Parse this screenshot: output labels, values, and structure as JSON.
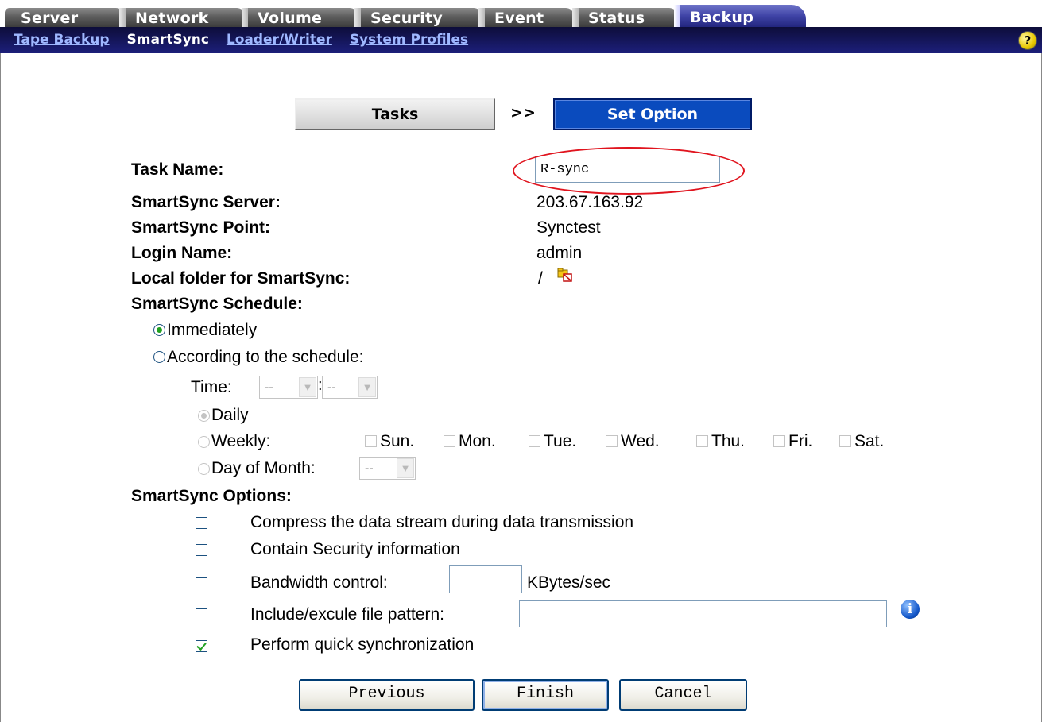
{
  "tabs": [
    "Server",
    "Network",
    "Volume",
    "Security",
    "Event",
    "Status",
    "Backup"
  ],
  "active_tab": "Backup",
  "subnav": {
    "links": [
      "Tape Backup",
      "SmartSync",
      "Loader/Writer",
      "System Profiles"
    ],
    "current": "SmartSync",
    "help_icon": "?"
  },
  "steps": {
    "tasks": "Tasks",
    "arrow": ">>",
    "set_option": "Set Option"
  },
  "form": {
    "task_name_label": "Task Name:",
    "task_name_value": "R-sync",
    "server_label": "SmartSync Server:",
    "server_value": "203.67.163.92",
    "point_label": "SmartSync Point:",
    "point_value": "Synctest",
    "login_label": "Login Name:",
    "login_value": "admin",
    "folder_label": "Local folder for SmartSync:",
    "folder_value": "/",
    "schedule_label": "SmartSync Schedule:",
    "immediately": "Immediately",
    "according": "According to the schedule:",
    "time_label": "Time:",
    "time_hour": "--",
    "time_minute": "--",
    "daily": "Daily",
    "weekly": "Weekly:",
    "days": [
      "Sun.",
      "Mon.",
      "Tue.",
      "Wed.",
      "Thu.",
      "Fri.",
      "Sat."
    ],
    "day_of_month": "Day of Month:",
    "day_of_month_value": "--",
    "options_label": "SmartSync Options:",
    "opt_compress": "Compress the data stream during data transmission",
    "opt_security": "Contain Security information",
    "opt_bandwidth": "Bandwidth control:",
    "opt_bandwidth_unit": "KBytes/sec",
    "opt_pattern": "Include/excule file pattern:",
    "opt_quick": "Perform quick synchronization"
  },
  "buttons": {
    "previous": "Previous",
    "finish": "Finish",
    "cancel": "Cancel"
  },
  "colors": {
    "accent": "#0a4bbe",
    "active_tab": "#3f43a6",
    "highlight_ring": "#e0141e"
  }
}
